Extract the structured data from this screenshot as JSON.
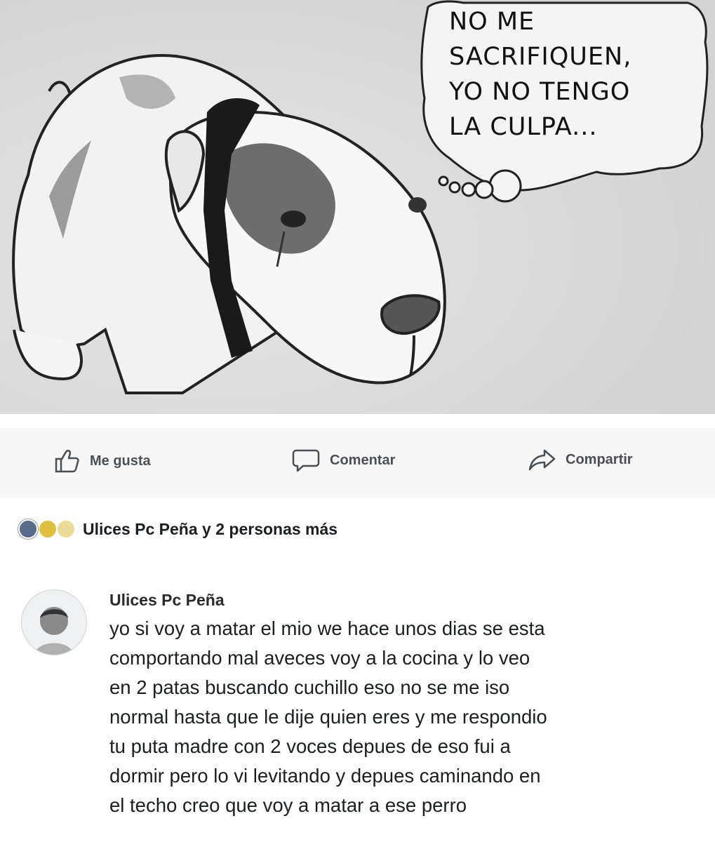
{
  "post_image": {
    "speech_bubble_lines": [
      "NO ME",
      "SACRIFIQUEN,",
      "YO NO TENGO",
      "LA CULPA..."
    ]
  },
  "action_bar": {
    "like_label": "Me gusta",
    "comment_label": "Comentar",
    "share_label": "Compartir"
  },
  "reactions": {
    "icons": [
      "like-icon",
      "haha-icon",
      "sad-icon"
    ],
    "summary": "Ulices Pc Peña y 2 personas más"
  },
  "comment": {
    "author": "Ulices Pc Peña",
    "text": "yo si voy a matar el mio we hace unos dias se esta\ncomportando mal aveces voy a la cocina y lo veo\nen 2 patas buscando cuchillo eso no se me iso\nnormal hasta que le dije quien eres y me respondio\ntu puta madre con 2 voces depues de eso fui a\ndormir pero lo vi levitando y depues caminando en\nel techo creo que voy a matar a ese perro"
  }
}
